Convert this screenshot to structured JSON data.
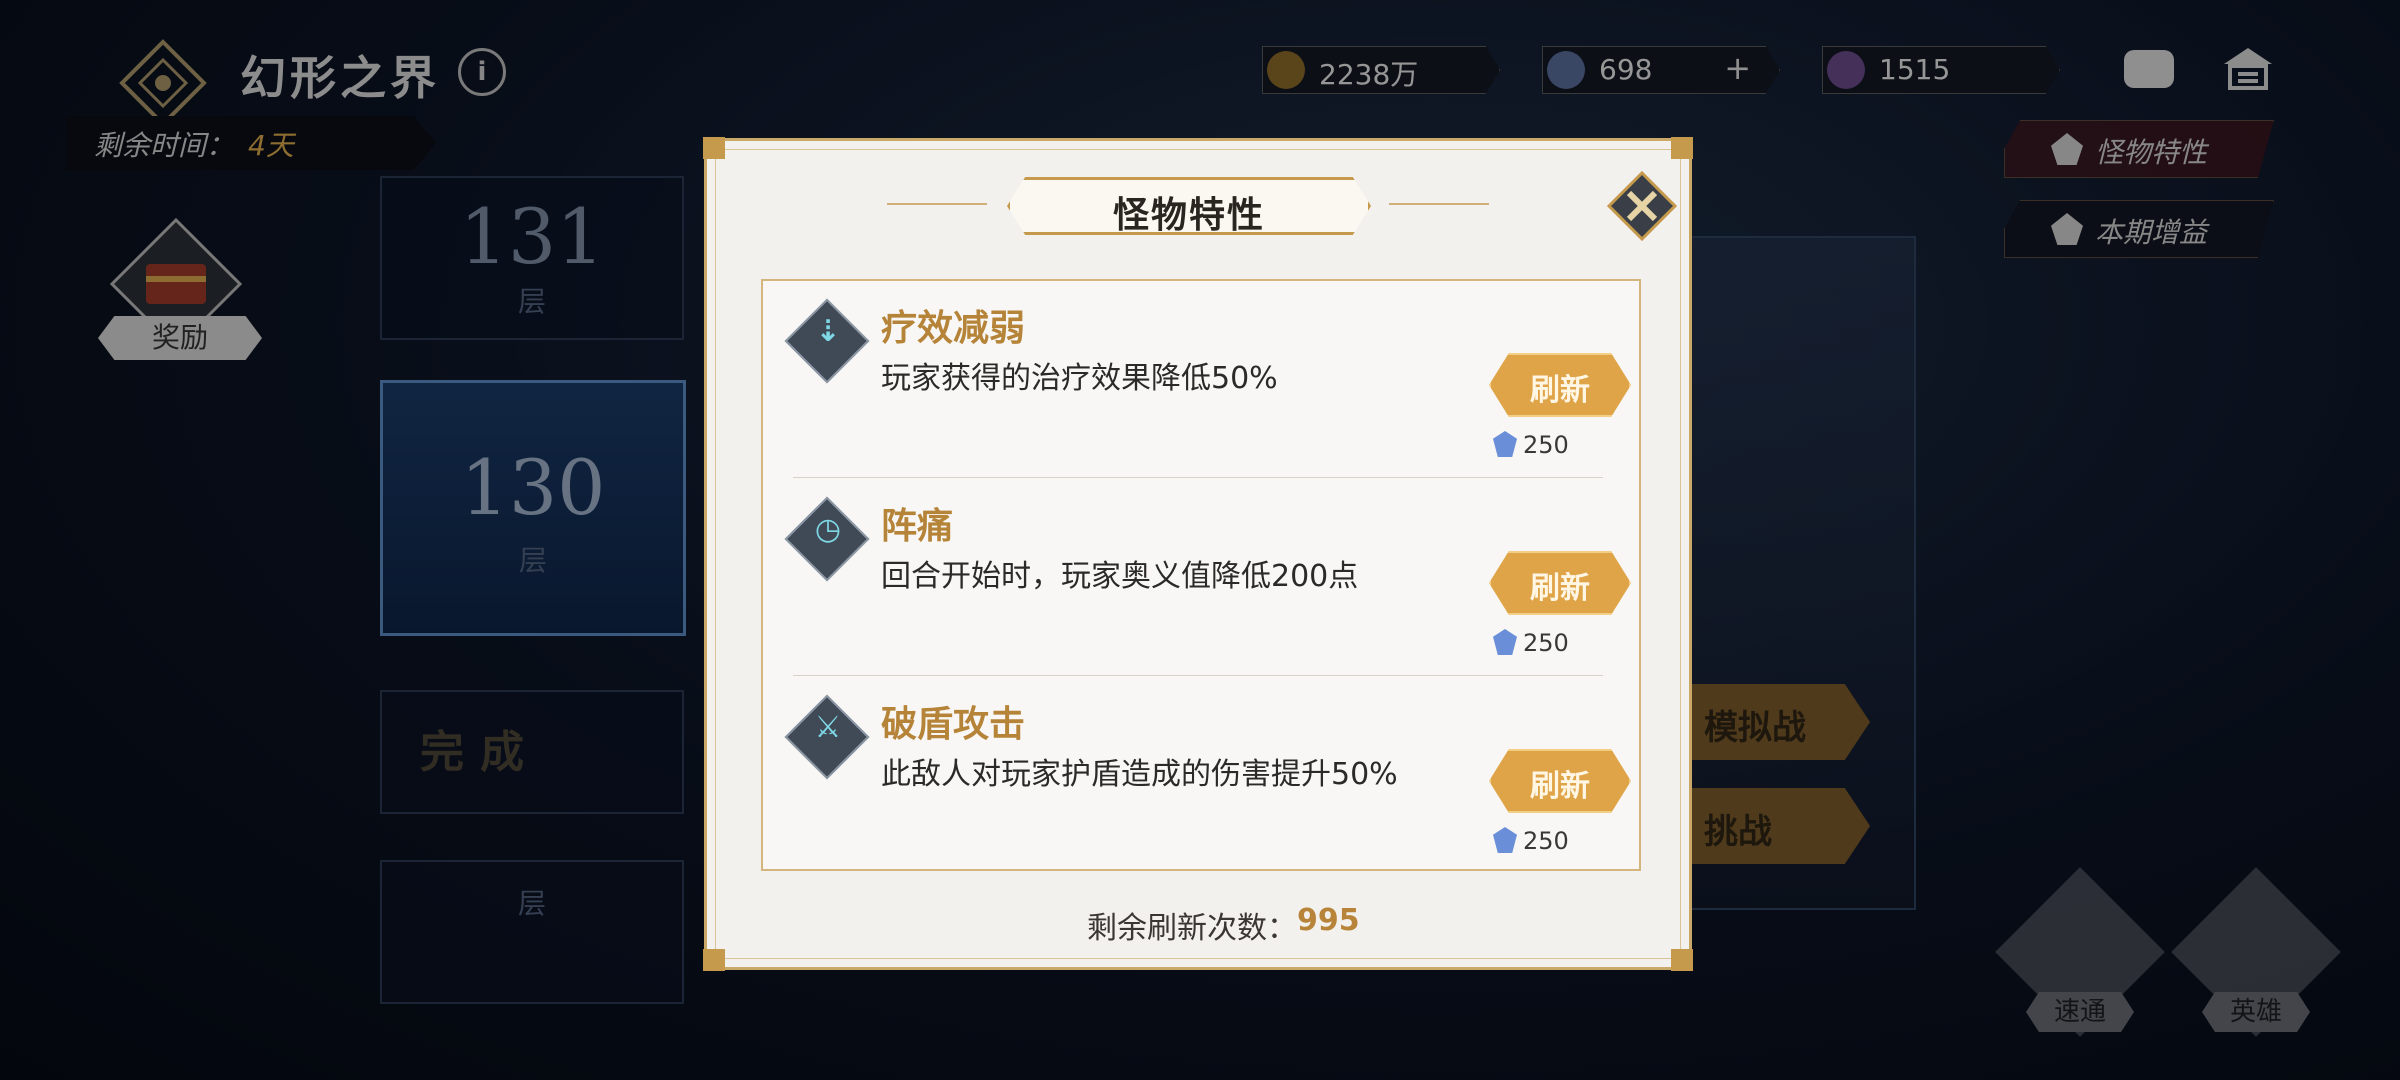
{
  "header": {
    "title": "幻形之界",
    "timer_label": "剩余时间：",
    "timer_value": "4天"
  },
  "resources": [
    {
      "icon": "coin-icon",
      "value": "2238万"
    },
    {
      "icon": "crystal-icon",
      "value": "698",
      "plus": "+"
    },
    {
      "icon": "star-shard-icon",
      "value": "1515"
    }
  ],
  "side_buttons": {
    "monster_traits": "怪物特性",
    "season_buff": "本期增益"
  },
  "reward": {
    "label": "奖励"
  },
  "floors": {
    "upper_num": "131",
    "upper_sub": "层",
    "current_num": "130",
    "current_sub": "层",
    "done_label": "完成",
    "done_sub": "层"
  },
  "actions": {
    "simulate": "模拟战",
    "challenge": "挑战"
  },
  "corner_buttons": {
    "sweep": "速通",
    "hero": "英雄"
  },
  "modal": {
    "title": "怪物特性",
    "traits": [
      {
        "name": "疗效减弱",
        "desc": "玩家获得的治疗效果降低50%",
        "button": "刷新",
        "cost": "250"
      },
      {
        "name": "阵痛",
        "desc": "回合开始时，玩家奥义值降低200点",
        "button": "刷新",
        "cost": "250"
      },
      {
        "name": "破盾攻击",
        "desc": "此敌人对玩家护盾造成的伤害提升50%",
        "button": "刷新",
        "cost": "250"
      }
    ],
    "remaining_label": "剩余刷新次数：",
    "remaining_value": "995"
  },
  "colors": {
    "gold": "#c59a4c",
    "trait_name": "#b58438",
    "refresh_button": "#e0a448",
    "modal_bg": "#f3f1ee"
  }
}
